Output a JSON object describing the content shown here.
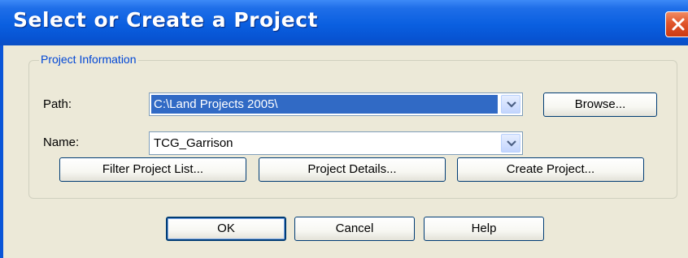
{
  "window": {
    "title": "Select or Create a Project"
  },
  "project_info": {
    "group_title": "Project Information",
    "path_label": "Path:",
    "path_value": "C:\\Land Projects 2005\\",
    "name_label": "Name:",
    "name_value": "TCG_Garrison",
    "browse_label": "Browse...",
    "filter_label": "Filter Project List...",
    "details_label": "Project Details...",
    "create_label": "Create Project..."
  },
  "footer": {
    "ok_label": "OK",
    "cancel_label": "Cancel",
    "help_label": "Help"
  },
  "icons": {
    "close": "close-icon",
    "dropdown": "chevron-down-icon"
  },
  "colors": {
    "titlebar": "#0a5fe0",
    "close_button": "#e0552b",
    "dialog_background": "#ece9d8",
    "selection": "#316ac5",
    "group_title": "#0046d5"
  }
}
